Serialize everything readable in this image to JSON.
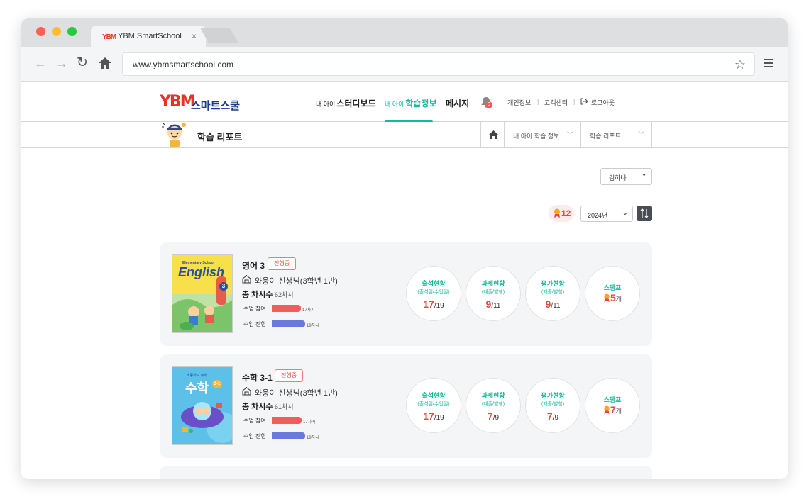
{
  "browser": {
    "tab_logo": "YBM",
    "tab_title": "YBM SmartSchool",
    "tab_close": "×",
    "url": "www.ybmsmartschool.com"
  },
  "site": {
    "logo_mark": "YBM",
    "logo_text": "스마트스쿨",
    "nav": [
      {
        "prefix": "내 아이",
        "label": "스터디보드",
        "active": false
      },
      {
        "prefix": "내 아이",
        "label": "학습정보",
        "active": true
      },
      {
        "prefix": "",
        "label": "메시지",
        "active": false
      }
    ],
    "notification_count": "0",
    "util": {
      "profile": "개인정보",
      "support": "고객센터",
      "logout": "로그아웃"
    },
    "accent_color": "#14b99a"
  },
  "subheader": {
    "page_title": "학습 리포트",
    "crumbs": [
      "내 아이 학습 정보",
      "학습 리포트"
    ]
  },
  "filters": {
    "child": "김하나",
    "year": "2024년",
    "total_stamps": "12"
  },
  "courses": [
    {
      "cover_title": "English",
      "cover_tag": "Elementary School",
      "cover_grade": "3",
      "name": "영어 3",
      "status": "진행중",
      "teacher": "와웅이 선생님(3학년 1반)",
      "total_label": "총 차시수",
      "total_value": "62차시",
      "participation_label": "수업 참여",
      "participation_text": "17차시",
      "participation": 0.27,
      "progress_label": "수업 진행",
      "progress_text": "19차시",
      "progress": 0.31,
      "stats": [
        {
          "title": "출석현황",
          "sub": "(출석일/수업일)",
          "done": "17",
          "total": "/19"
        },
        {
          "title": "과제현황",
          "sub": "(제출/발행)",
          "done": "9",
          "total": "/11"
        },
        {
          "title": "평가현황",
          "sub": "(제출/발행)",
          "done": "9",
          "total": "/11"
        }
      ],
      "stamp_title": "스탬프",
      "stamp_count": "5",
      "stamp_unit": "개"
    },
    {
      "cover_title": "수학",
      "cover_tag": "초등학교 수학",
      "cover_grade": "3-1",
      "name": "수학 3-1",
      "status": "진행중",
      "teacher": "와웅이 선생님(3학년 1반)",
      "total_label": "총 차시수",
      "total_value": "61차시",
      "participation_label": "수업 참여",
      "participation_text": "17차시",
      "participation": 0.28,
      "progress_label": "수업 진행",
      "progress_text": "19차시",
      "progress": 0.31,
      "stats": [
        {
          "title": "출석현황",
          "sub": "(출석일/수업일)",
          "done": "17",
          "total": "/19"
        },
        {
          "title": "과제현황",
          "sub": "(제출/발행)",
          "done": "7",
          "total": "/9"
        },
        {
          "title": "평가현황",
          "sub": "(제출/발행)",
          "done": "7",
          "total": "/9"
        }
      ],
      "stamp_title": "스탬프",
      "stamp_count": "7",
      "stamp_unit": "개"
    }
  ]
}
